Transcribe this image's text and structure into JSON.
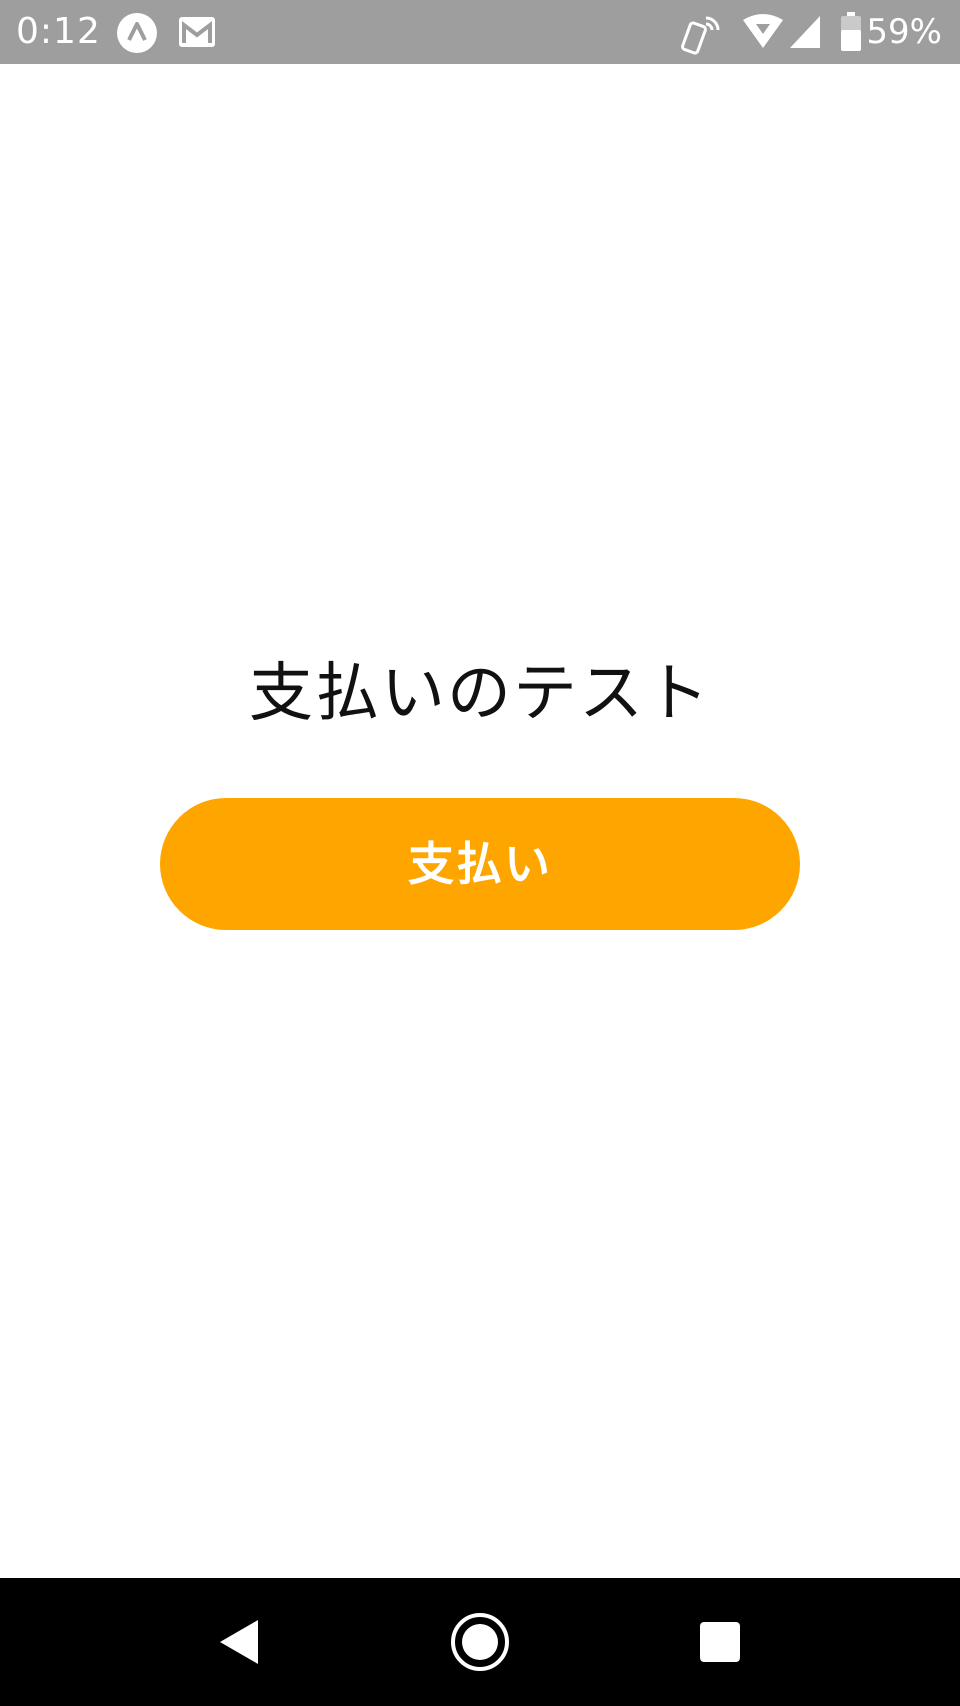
{
  "status_bar": {
    "time": "0:12",
    "battery_percent": "59%",
    "icons": [
      "app-a-icon",
      "gmail-icon",
      "rotate-phone-icon",
      "wifi-icon",
      "signal-icon",
      "battery-icon"
    ],
    "background": "#9e9e9e"
  },
  "main": {
    "title": "支払いのテスト",
    "pay_button_label": "支払い",
    "accent": "#ffa500"
  },
  "nav_bar": {
    "buttons": [
      "back-icon",
      "home-icon",
      "recents-icon"
    ],
    "background": "#000000"
  }
}
